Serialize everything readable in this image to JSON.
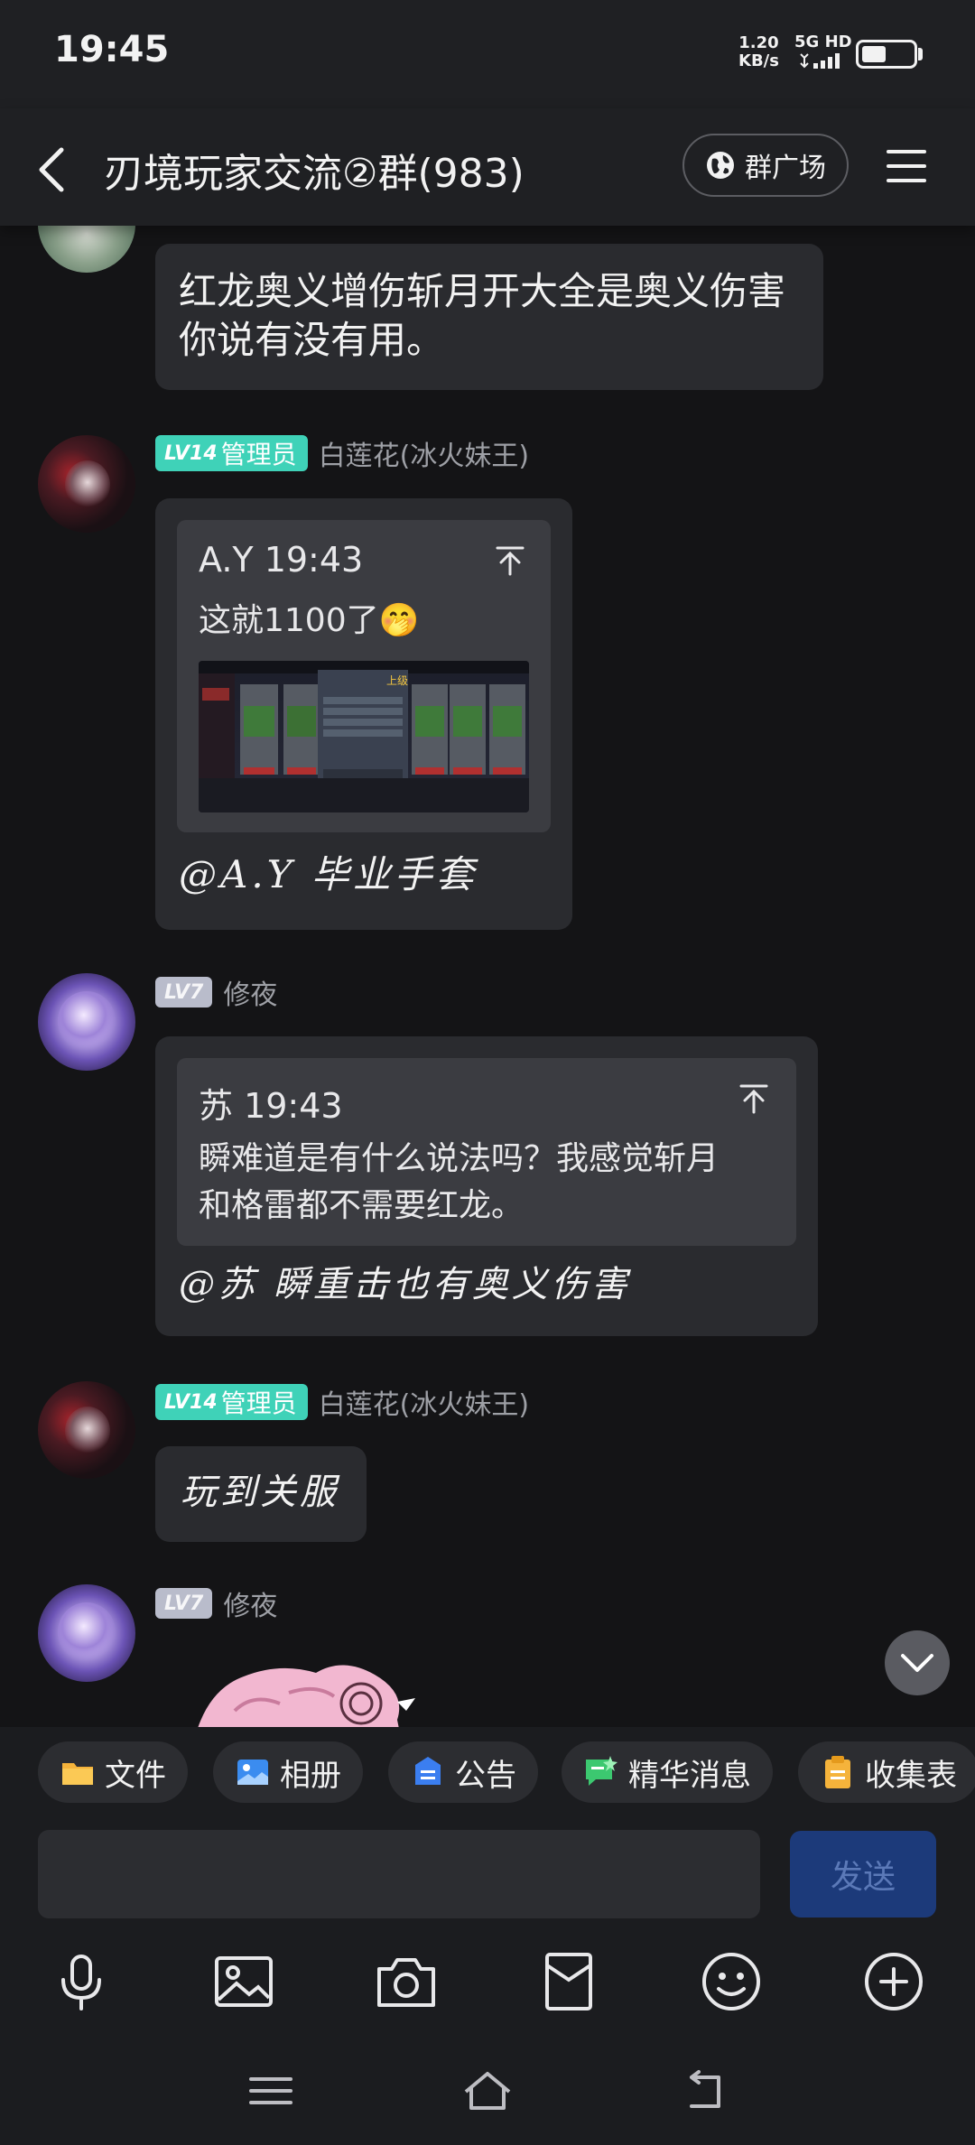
{
  "status_bar": {
    "time": "19:45",
    "speed_value": "1.20",
    "speed_unit": "KB/s",
    "network": "5G HD"
  },
  "header": {
    "title": "刃境玩家交流②群(983)",
    "plaza_label": "群广场"
  },
  "messages": [
    {
      "text": "红龙奥义增伤斩月开大全是奥义伤害你说有没有用。"
    },
    {
      "level": "LV14",
      "role": "管理员",
      "sender": "白莲花(冰火妹王)",
      "quote_author": "A.Y 19:43",
      "quote_text": "这就1100了🤭",
      "reply": "@A.Y 毕业手套"
    },
    {
      "level": "LV7",
      "sender": "修夜",
      "quote_author": "苏 19:43",
      "quote_text_line1": "瞬难道是有什么说法吗？我感觉斩月",
      "quote_text_line2": "和格雷都不需要红龙。",
      "reply": "@苏 瞬重击也有奥义伤害"
    },
    {
      "level": "LV14",
      "role": "管理员",
      "sender": "白莲花(冰火妹王)",
      "reply": "玩到关服"
    },
    {
      "level": "LV7",
      "sender": "修夜"
    }
  ],
  "game_screenshot": {
    "tag": "上级"
  },
  "shortcuts": [
    "文件",
    "相册",
    "公告",
    "精华消息",
    "收集表"
  ],
  "input": {
    "placeholder": "",
    "send_label": "发送"
  },
  "colors": {
    "background": "#141416",
    "bubble": "#2a2b2f",
    "admin_badge": "#3fd2b8",
    "send_button": "#1c3a7a"
  }
}
